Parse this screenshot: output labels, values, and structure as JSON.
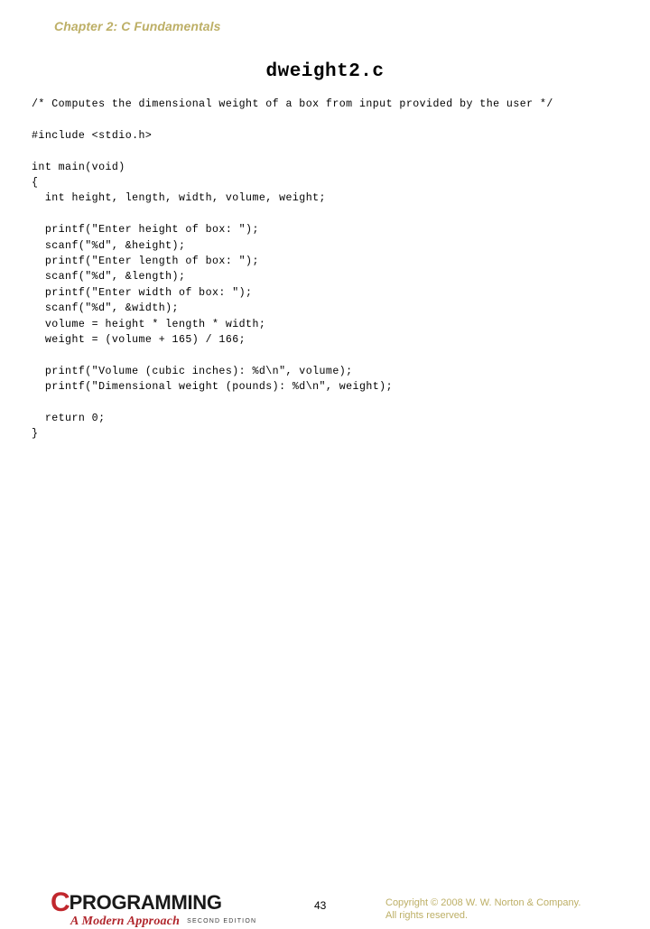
{
  "slide": {
    "chapter_header": "Chapter 2: C Fundamentals",
    "title": "dweight2.c"
  },
  "code": {
    "language": "c",
    "lines": [
      "/* Computes the dimensional weight of a box from input provided by the user */",
      "",
      "#include <stdio.h>",
      "",
      "int main(void)",
      "{",
      "  int height, length, width, volume, weight;",
      "",
      "  printf(\"Enter height of box: \");",
      "  scanf(\"%d\", &height);",
      "  printf(\"Enter length of box: \");",
      "  scanf(\"%d\", &length);",
      "  printf(\"Enter width of box: \");",
      "  scanf(\"%d\", &width);",
      "  volume = height * length * width;",
      "  weight = (volume + 165) / 166;",
      "",
      "  printf(\"Volume (cubic inches): %d\\n\", volume);",
      "  printf(\"Dimensional weight (pounds): %d\\n\", weight);",
      "",
      "  return 0;",
      "}"
    ]
  },
  "footer": {
    "logo": {
      "c_letter": "C",
      "wordmark": "PROGRAMMING",
      "subtitle": "A Modern Approach",
      "edition": "SECOND EDITION"
    },
    "page_number": "43",
    "copyright_line1": "Copyright © 2008 W. W. Norton & Company.",
    "copyright_line2": "All rights reserved."
  },
  "colors": {
    "accent_gold": "#bdaf66",
    "logo_red": "#c1272d",
    "text_black": "#000000",
    "background": "#ffffff"
  }
}
